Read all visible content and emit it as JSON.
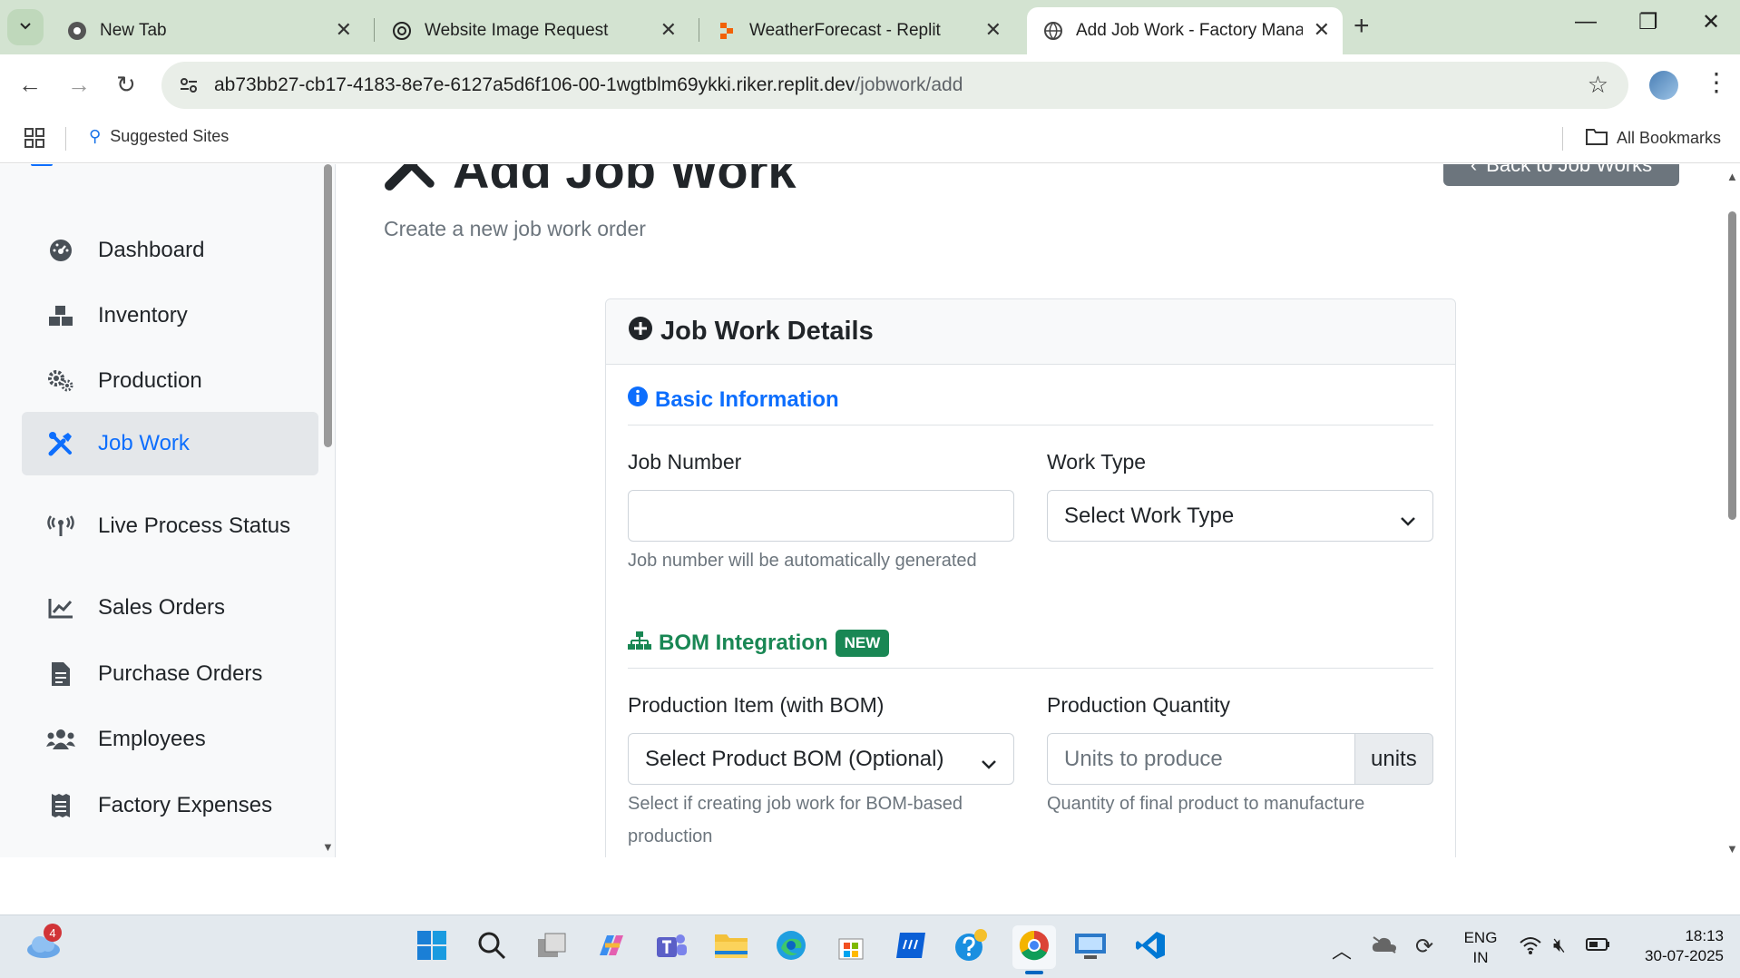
{
  "browser": {
    "tabs": [
      {
        "title": "New Tab",
        "icon": "chrome-icon"
      },
      {
        "title": "Website Image Request",
        "icon": "openai-icon"
      },
      {
        "title": "WeatherForecast - Replit",
        "icon": "replit-icon"
      },
      {
        "title": "Add Job Work - Factory Manage",
        "icon": "globe-icon",
        "active": true
      }
    ],
    "url_host": "ab73bb27-cb17-4183-8e7e-6127a5d6f106-00-1wgtblm69ykki.riker.replit.dev",
    "url_path": "/jobwork/add",
    "bookmarks": {
      "suggested": "Suggested Sites",
      "all": "All Bookmarks"
    }
  },
  "sidebar": {
    "items": [
      {
        "label": "Dashboard",
        "icon": "dashboard-icon"
      },
      {
        "label": "Inventory",
        "icon": "boxes-icon"
      },
      {
        "label": "Production",
        "icon": "cogs-icon"
      },
      {
        "label": "Job Work",
        "icon": "tools-icon",
        "active": true
      },
      {
        "label": "Live Process Status",
        "icon": "broadcast-icon"
      },
      {
        "label": "Sales Orders",
        "icon": "chart-line-icon"
      },
      {
        "label": "Purchase Orders",
        "icon": "file-invoice-icon"
      },
      {
        "label": "Employees",
        "icon": "users-icon"
      },
      {
        "label": "Factory Expenses",
        "icon": "receipt-icon"
      }
    ]
  },
  "page": {
    "title": "Add Job Work",
    "subtitle": "Create a new job work order",
    "back_label": "Back to Job Works"
  },
  "card": {
    "header": "Job Work Details",
    "basic_section": "Basic Information",
    "job_number_label": "Job Number",
    "job_number_value": "",
    "job_number_help": "Job number will be automatically generated",
    "work_type_label": "Work Type",
    "work_type_value": "Select Work Type",
    "bom_section": "BOM Integration",
    "bom_badge": "NEW",
    "production_item_label": "Production Item (with BOM)",
    "production_item_value": "Select Product BOM (Optional)",
    "production_item_help_1": "Select if creating job work for BOM-based",
    "production_item_help_2": "production",
    "quantity_label": "Production Quantity",
    "quantity_placeholder": "Units to produce",
    "quantity_unit": "units",
    "quantity_help": "Quantity of final product to manufacture"
  },
  "taskbar": {
    "weather_badge": "4",
    "lang_1": "ENG",
    "lang_2": "IN",
    "time": "18:13",
    "date": "30-07-2025"
  },
  "colors": {
    "primary": "#0d6efd",
    "success": "#198754",
    "secondary": "#6c757d"
  }
}
